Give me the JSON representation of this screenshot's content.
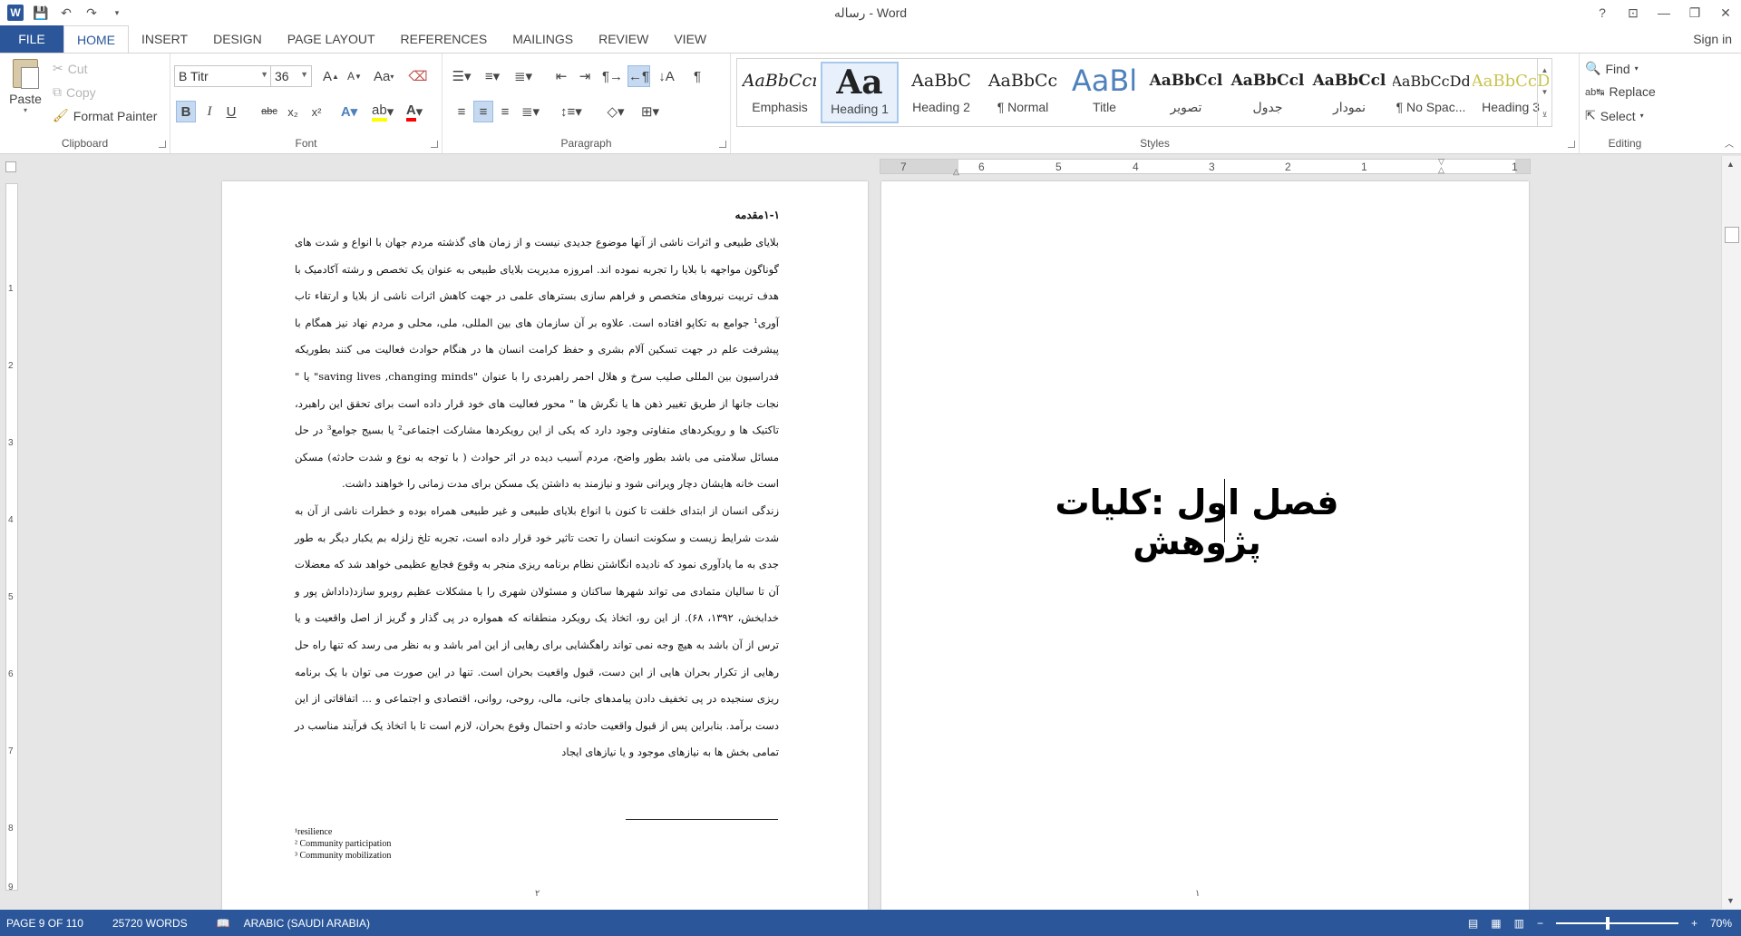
{
  "window": {
    "title": "رساله - Word",
    "help": "?",
    "controls": [
      "—",
      "❐",
      "✕"
    ]
  },
  "tabs": [
    "FILE",
    "HOME",
    "INSERT",
    "DESIGN",
    "PAGE LAYOUT",
    "REFERENCES",
    "MAILINGS",
    "REVIEW",
    "VIEW"
  ],
  "sign_in": "Sign in",
  "clipboard": {
    "paste": "Paste",
    "cut": "Cut",
    "copy": "Copy",
    "format_painter": "Format Painter",
    "label": "Clipboard"
  },
  "font": {
    "name": "B Titr",
    "size": "36",
    "label": "Font",
    "bold": "B",
    "italic": "I",
    "underline": "U",
    "strike": "abc",
    "sub": "x₂",
    "sup": "x²",
    "grow": "A",
    "shrink": "A",
    "case": "Aa"
  },
  "paragraph": {
    "label": "Paragraph"
  },
  "styles": {
    "label": "Styles",
    "items": [
      {
        "preview": "AaBbCcı",
        "name": "Emphasis"
      },
      {
        "preview": "Aa",
        "name": "Heading 1"
      },
      {
        "preview": "AaBbC",
        "name": "Heading 2"
      },
      {
        "preview": "AaBbCc",
        "name": "¶ Normal"
      },
      {
        "preview": "AaBl",
        "name": "Title"
      },
      {
        "preview": "AaBbCcl",
        "name": "تصویر"
      },
      {
        "preview": "AaBbCcl",
        "name": "جدول"
      },
      {
        "preview": "AaBbCcl",
        "name": "نمودار"
      },
      {
        "preview": "AaBbCcDd",
        "name": "¶ No Spac..."
      },
      {
        "preview": "AaBbCcD",
        "name": "Heading 3"
      }
    ]
  },
  "editing": {
    "label": "Editing",
    "find": "Find",
    "replace": "Replace",
    "select": "Select"
  },
  "hruler_numbers": [
    "7",
    "6",
    "5",
    "4",
    "3",
    "2",
    "1",
    "1"
  ],
  "vruler_numbers": [
    "1",
    "2",
    "3",
    "4",
    "5",
    "6",
    "7",
    "8",
    "9"
  ],
  "left_page": {
    "heading": "۱-۱مقدمه",
    "paragraph1": "بلایای طبیعی و اثرات ناشی از آنها موضوع جدیدی نیست و از زمان های گذشته مردم جهان با انواع و شدت های گوناگون مواجهه با بلایا را تجربه نموده اند. امروزه مدیریت بلایای طبیعی به عنوان یک تخصص و رشته آکادمیک با هدف تربیت نیروهای متخصص و فراهم سازی بسترهای علمی در جهت کاهش اثرات ناشی از بلایا و ارتقاء تاب آوری¹ جوامع به تکاپو افتاده است. علاوه بر آن سازمان های بین المللی، ملی، محلی و مردم نهاد نیز همگام با پیشرفت علم در جهت تسکین آلام بشری و حفظ کرامت انسان ها در هنگام حوادث فعالیت می کنند بطوریکه فدراسیون بین المللی صلیب سرخ و هلال احمر راهبردی را با عنوان \"saving lives ,changing minds\" یا \" نجات جانها از طریق تغییر ذهن ها یا نگرش ها \" محور فعالیت های خود قرار داده است برای تحقق این راهبرد، تاکتیک ها و رویکردهای متفاوتی وجود دارد که یکی از این رویکردها مشارکت اجتماعی² یا بسیج جوامع³ در حل مسائل سلامتی می باشد بطور واضح، مردم آسیب دیده در اثر حوادث ( با توجه به نوع و شدت حادثه) مسکن است خانه هایشان دچار ویرانی شود و نیازمند به داشتن یک مسکن برای مدت زمانی را خواهند داشت.",
    "paragraph2": "زندگی انسان از ابتدای خلقت تا کنون با انواع بلایای طبیعی و غیر طبیعی همراه بوده و خطرات ناشی از آن به شدت شرایط زیست و سکونت انسان را تحت تاثیر خود قرار داده است، تجربه تلخ زلزله بم یکبار دیگر به طور جدی به ما یادآوری نمود که نادیده انگاشتن نظام برنامه ریزی منجر به وقوع فجایع عظیمی خواهد شد که معضلات آن تا سالیان متمادی می تواند شهرها ساکنان و مسئولان شهری را با مشکلات عظیم روبرو سازد(داداش پور و خدابخش، ۱۳۹۲، ۶۸). از این رو، اتخاذ یک رویکرد منطقانه که همواره در پی گذار و گریز از اصل واقعیت و یا ترس از آن باشد به هیچ وجه نمی تواند راهگشایی برای رهایی از این امر باشد و به نظر می رسد که تنها راه حل رهایی از تکرار بحران هایی از این دست، قبول واقعیت بحران است. تنها در این صورت می توان با یک برنامه ریزی سنجیده در پی تخفیف دادن پیامدهای جانی، مالی، روحی، روانی، اقتصادی و اجتماعی و ... اتفاقاتی از این دست برآمد. بنابراین پس از قبول واقعیت حادثه و احتمال وقوع بحران، لازم است تا با اتخاذ یک فرآیند مناسب در تمامی بخش ها به نیازهای موجود و یا نیازهای ایجاد",
    "footnotes": [
      "¹resilience",
      "² Community participation",
      "³ Community mobilization"
    ],
    "page_number": "۲"
  },
  "right_page": {
    "chapter_title": "فصل اول :کلیات پژوهش",
    "page_number": "۱"
  },
  "status": {
    "page": "PAGE 9 OF 110",
    "words": "25720 WORDS",
    "language": "ARABIC (SAUDI ARABIA)",
    "zoom": "70%"
  }
}
